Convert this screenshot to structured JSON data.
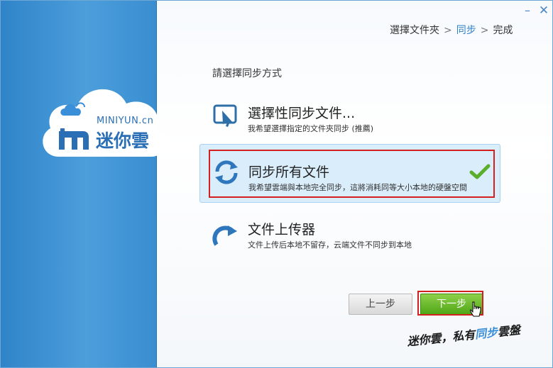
{
  "window": {
    "minimize_glyph": "–",
    "close_glyph": "✕"
  },
  "brand": {
    "logo_en": "MINIYUN.cn",
    "logo_cn": "迷你雲"
  },
  "breadcrumb": {
    "step1": "選擇文件夾",
    "sep1": ">",
    "step2": "同步",
    "sep2": ">",
    "step3": "完成"
  },
  "prompt": "請選擇同步方式",
  "options": [
    {
      "title": "選擇性同步文件...",
      "desc": "我希望選擇指定的文件夾同步 (推薦)",
      "icon": "select-cursor-icon"
    },
    {
      "title": "同步所有文件",
      "desc": "我希望雲端與本地完全同步，這將消耗同等大小本地的硬盤空間",
      "icon": "sync-arrows-icon",
      "selected": true
    },
    {
      "title": "文件上传器",
      "desc": "文件上传后本地不留存，云端文件不同步到本地",
      "icon": "upload-arrow-icon"
    }
  ],
  "buttons": {
    "prev": "上一步",
    "next": "下一步"
  },
  "slogan": {
    "part1": "迷你雲，私有",
    "part2": "同步",
    "part3": "雲盤"
  },
  "colors": {
    "accent": "#2f7fc9",
    "sidebar": "#3a8ed0",
    "selected_bg": "#daedfb",
    "next_button": "#5fb524",
    "highlight": "#d21f1f"
  }
}
